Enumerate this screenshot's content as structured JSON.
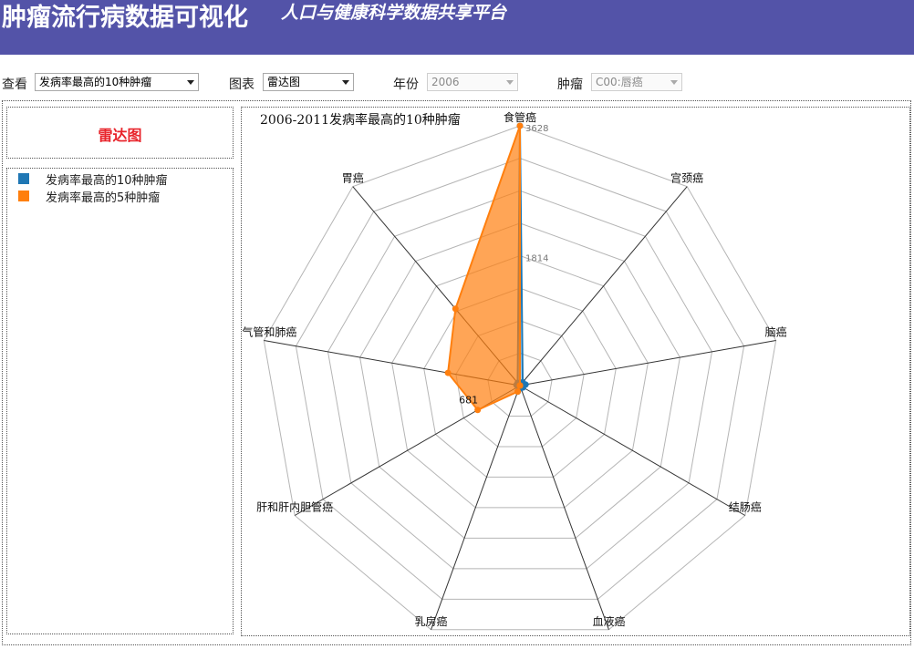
{
  "header": {
    "title": "肿瘤流行病数据可视化",
    "subtitle": "人口与健康科学数据共享平台"
  },
  "controls": {
    "view_label": "查看",
    "view_value": "发病率最高的10种肿瘤",
    "chart_label": "图表",
    "chart_value": "雷达图",
    "year_label": "年份",
    "year_value": "2006",
    "tumor_label": "肿瘤",
    "tumor_value": "C00:唇癌"
  },
  "left_panel": {
    "title": "雷达图",
    "legend": [
      {
        "label": "发病率最高的10种肿瘤",
        "color": "#1f77b4"
      },
      {
        "label": "发病率最高的5种肿瘤",
        "color": "#ff7f0e"
      }
    ]
  },
  "chart_data": {
    "type": "radar",
    "title": "2006-2011发病率最高的10种肿瘤",
    "axes": [
      "食管癌",
      "宫颈癌",
      "脑癌",
      "结肠癌",
      "血液癌",
      "乳房癌",
      "肝和肝内胆管癌",
      "支气管和肺癌",
      "胃癌"
    ],
    "max": 3628,
    "levels": 8,
    "tick_labels": [
      "1814",
      "3628"
    ],
    "data_labels": [
      {
        "text": "681",
        "axis": "肝和肝内胆管癌",
        "value": 681
      },
      {
        "text": "3628",
        "axis": "食管癌",
        "value": 3628
      },
      {
        "text": "1814",
        "axis": "食管癌",
        "value": 1814
      }
    ],
    "series": [
      {
        "name": "发病率最高的10种肿瘤",
        "color": "#1f77b4",
        "values": [
          3628,
          60,
          80,
          50,
          40,
          90,
          30,
          50,
          50
        ]
      },
      {
        "name": "发病率最高的5种肿瘤",
        "color": "#ff7f0e",
        "values": [
          3628,
          0,
          0,
          0,
          0,
          90,
          681,
          1020,
          1400
        ]
      }
    ]
  }
}
